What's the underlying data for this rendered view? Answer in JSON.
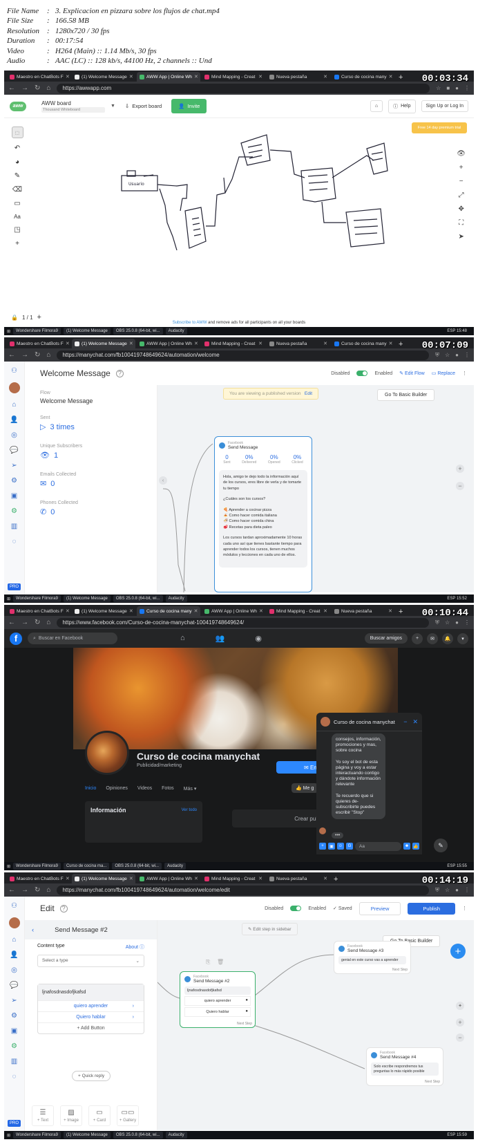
{
  "info": {
    "rows": [
      {
        "k": "File Name",
        "v": "3. Explicacion en pizzara sobre los flujos de chat.mp4"
      },
      {
        "k": "File Size",
        "v": "166.58 MB"
      },
      {
        "k": "Resolution",
        "v": "1280x720 / 30 fps"
      },
      {
        "k": "Duration",
        "v": "00:17:54"
      },
      {
        "k": "Video",
        "v": "H264 (Main) :: 1.14 Mb/s, 30 fps"
      },
      {
        "k": "Audio",
        "v": "AAC (LC) :: 128 kb/s, 44100 Hz, 2 channels :: Und"
      }
    ]
  },
  "shot1": {
    "timestamp": "00:03:34",
    "tabs": [
      "Maestro en ChatBots F",
      "(1) Welcome Message",
      "AWW App | Online Wh",
      "Mind Mapping - Creat",
      "Nueva pestaña",
      "Curso de cocina many"
    ],
    "url": "https://awwapp.com",
    "board_name": "AWW board",
    "board_sub": "Thousand Whiteboard",
    "export": "Export board",
    "invite": "Invite",
    "help": "Help",
    "signup": "Sign Up or Log In",
    "promo": "Free 14 day premium trial",
    "page_num": "1 / 1",
    "subscribe_link": "Subscribe to AWW",
    "subscribe_rest": " and remove ads for all participants on all your boards",
    "scribble": "Usuario",
    "taskbar": [
      "Wondershare Filmora9",
      "(1) Welcome Message",
      "OBS 25.0.8 (64-bit, wi...",
      "Audacity"
    ],
    "clock": "ESP 15:48"
  },
  "shot2": {
    "timestamp": "00:07:09",
    "tabs": [
      "Maestro en ChatBots F",
      "(1) Welcome Message",
      "AWW App | Online Wh",
      "Mind Mapping - Creat",
      "Nueva pestaña",
      "Curso de cocina many"
    ],
    "url": "https://manychat.com/fb100419748649624/automation/welcome",
    "title": "Welcome Message",
    "disabled": "Disabled",
    "enabled": "Enabled",
    "edit_flow": "Edit Flow",
    "replace": "Replace",
    "published": "You are viewing a published version",
    "published_edit": "Edit",
    "basic_builder": "Go To Basic Builder",
    "flow_label": "Flow",
    "flow_value": "Welcome Message",
    "sent_label": "Sent",
    "sent_value": "3 times",
    "unique_label": "Unique Subscribers",
    "unique_value": "1",
    "emails_label": "Emails Collected",
    "emails_value": "0",
    "phones_label": "Phones Collected",
    "phones_value": "0",
    "card": {
      "source": "Facebook",
      "title": "Send Message",
      "stats": [
        {
          "n": "0",
          "l": "Sent"
        },
        {
          "n": "0%",
          "l": "Delivered"
        },
        {
          "n": "0%",
          "l": "Opened"
        },
        {
          "n": "0%",
          "l": "Clicked"
        }
      ],
      "p1": "Hola, amigo te dejo todo la información aquí de los cursos, eres libre de verla y de tomarte tu tiempo",
      "p2": "¿Cuáles son los cursos?",
      "items": [
        "Aprender a cocinar pizza",
        "Como hacer comida italiana",
        "Como hacer comida china",
        "Recetas para dieta paleo"
      ],
      "p3": "Los cursos tardan aproximadamente 10 horas cada uno así que tienes bastante tiempo para aprender todos los cursos, tienen muchos módulos y lecciones en cada uno de ellos."
    },
    "pro": "PRO",
    "taskbar": [
      "Wondershare Filmora9",
      "(1) Welcome Message",
      "OBS 25.0.8 (64-bit, wi...",
      "Audacity"
    ],
    "clock": "ESP 15:52"
  },
  "shot3": {
    "timestamp": "00:10:44",
    "tabs": [
      "Maestro en ChatBots F",
      "(1) Welcome Message",
      "Curso de cocina many",
      "AWW App | Online Wh",
      "Mind Mapping - Creat",
      "Nueva pestaña"
    ],
    "url": "https://www.facebook.com/Curso-de-cocina-manychat-100419748649624/",
    "search": "Buscar en Facebook",
    "find_friends": "Buscar amigos",
    "page_name": "Curso de cocina manychat",
    "category": "Publicidad/marketing",
    "send_btn": "Env",
    "tabs_page": [
      "Inicio",
      "Opiniones",
      "Videos",
      "Fotos",
      "Más ▾"
    ],
    "like_btn": "Me g",
    "info_title": "Información",
    "info_all": "Ver todo",
    "create_post": "Crear publicació",
    "chat_name": "Curso de cocina manychat",
    "chat_p1": "consejos, información, promociones y mas, sobre cocina",
    "chat_p2": "Yo soy el bot de esta página y voy a estar interactuando contigo y dándote información relevante",
    "chat_p3": "Te recuerdo que si quieres de-subscribirte puedes escribir \"Stop\"",
    "chat_input": "Aa",
    "taskbar": [
      "Wondershare Filmora9",
      "Curso de cocina ma...",
      "OBS 25.0.8 (64-bit, wi...",
      "Audacity"
    ],
    "clock": "ESP 15:55"
  },
  "shot4": {
    "timestamp": "00:14:19",
    "tabs": [
      "Maestro en ChatBots F",
      "(1) Welcome Message",
      "AWW App | Online Wh",
      "Mind Mapping - Creat",
      "Nueva pestaña"
    ],
    "url": "https://manychat.com/fb100419748649624/automation/welcome/edit",
    "title": "Edit",
    "disabled": "Disabled",
    "enabled": "Enabled",
    "saved": "✓ Saved",
    "preview": "Preview",
    "publish": "Publish",
    "edit_sidebar": "Edit step in sidebar",
    "basic_builder": "Go To Basic Builder",
    "panel_title": "Send Message #2",
    "content_type": "Content type",
    "about": "About",
    "select_type": "Select a type",
    "text_block": "ljnafosdnasdofjkafsd",
    "btn1": "quiero aprender",
    "btn2": "Quiero hablar",
    "add_button": "+ Add Button",
    "quick_reply": "+ Quick reply",
    "tools": [
      "+ Text",
      "+ Image",
      "+ Card",
      "+ Gallery"
    ],
    "node_main": {
      "source": "Facebook",
      "title": "Send Message #2",
      "text": "ljnafosdnasdofjkafsd",
      "b1": "quiero aprender",
      "b2": "Quiero hablar",
      "next": "Next Step"
    },
    "node3": {
      "source": "Facebook",
      "title": "Send Message #3",
      "text": "genial en este curso vas a aprender",
      "next": "Next Step"
    },
    "node4": {
      "source": "Facebook",
      "title": "Send Message #4",
      "text": "Solo escribe respondremos tus preguntas lo más rápido posible",
      "next": "Next Step"
    },
    "pro": "PRO",
    "taskbar": [
      "Wondershare Filmora9",
      "(1) Welcome Message",
      "OBS 25.0.8 (64-bit, wi...",
      "Audacity"
    ],
    "clock": "ESP 15:59"
  }
}
